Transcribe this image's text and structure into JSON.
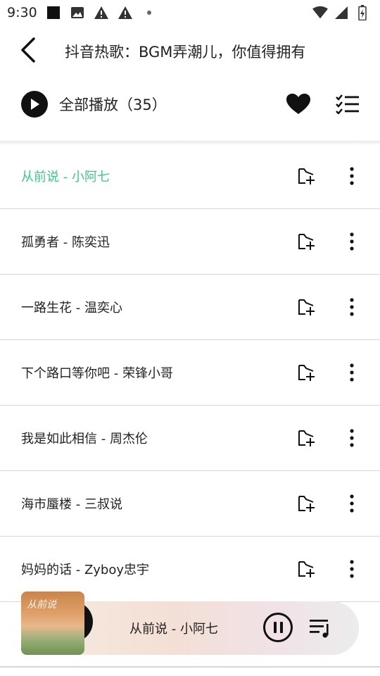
{
  "status_bar": {
    "time": "9:30",
    "left_icons": [
      "app-square-icon",
      "image-icon",
      "warning-icon",
      "warning-icon",
      "dot-icon"
    ],
    "right_icons": [
      "wifi-icon",
      "signal-icon",
      "battery-icon"
    ]
  },
  "header": {
    "title": "抖音热歌：BGM弄潮儿，你值得拥有",
    "back_icon": "chevron-left-icon"
  },
  "toolbar": {
    "play_all_label": "全部播放（35）",
    "favorite_icon": "heart-icon",
    "multi_select_icon": "checklist-icon"
  },
  "songs": [
    {
      "title": "从前说 - 小阿七",
      "active": true
    },
    {
      "title": "孤勇者 - 陈奕迅",
      "active": false
    },
    {
      "title": "一路生花 - 温奕心",
      "active": false
    },
    {
      "title": "下个路口等你吧 - 荣锋小哥",
      "active": false
    },
    {
      "title": "我是如此相信 - 周杰伦",
      "active": false
    },
    {
      "title": "海市蜃楼 - 三叔说",
      "active": false
    },
    {
      "title": "妈妈的话 - Zyboy忠宇",
      "active": false
    }
  ],
  "colors": {
    "active_song": "#3ec98a",
    "text": "#222222",
    "divider": "#d6d6d6"
  },
  "player": {
    "now_playing": "从前说 - 小阿七",
    "cover_text": "从前说",
    "state": "playing"
  }
}
